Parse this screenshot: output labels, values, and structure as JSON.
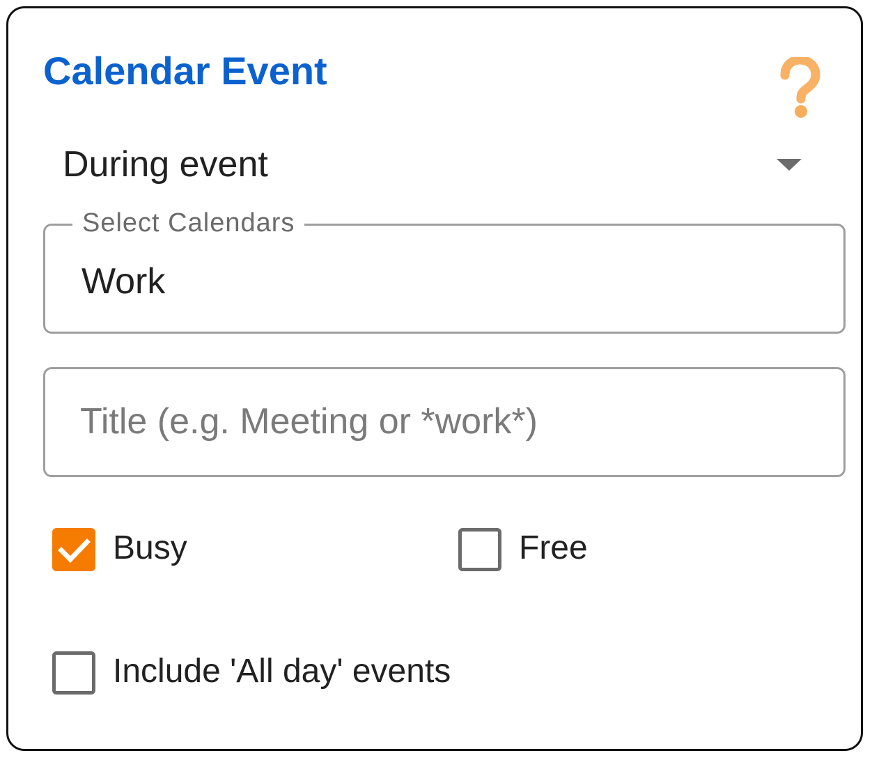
{
  "card": {
    "title": "Calendar Event",
    "help_icon": "question-mark-icon"
  },
  "event_timing": {
    "selected_value": "During event",
    "dropdown_icon": "arrow-drop-down-icon"
  },
  "calendars_field": {
    "label": "Select Calendars",
    "value": "Work"
  },
  "title_field": {
    "value": "",
    "placeholder": "Title (e.g. Meeting or *work*)"
  },
  "availability": {
    "busy": {
      "label": "Busy",
      "checked": true
    },
    "free": {
      "label": "Free",
      "checked": false
    }
  },
  "all_day": {
    "label": "Include 'All day' events",
    "checked": false
  },
  "colors": {
    "title": "#0b62cf",
    "accent": "#f57c00",
    "help_icon": "#f8ad5d",
    "outline": "#9e9e9e"
  }
}
